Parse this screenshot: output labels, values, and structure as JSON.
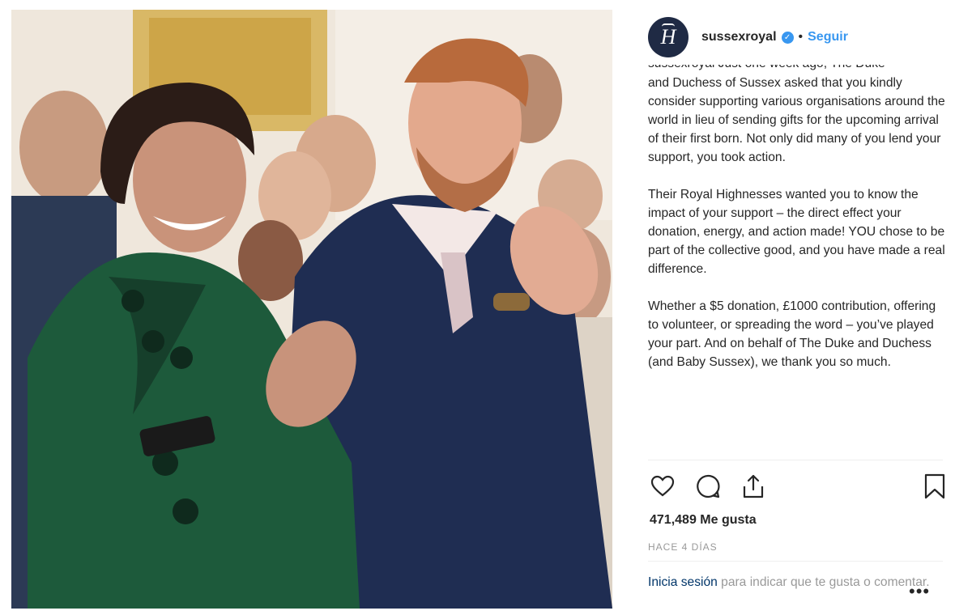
{
  "post": {
    "photo_alt": "",
    "header": {
      "avatar_letter": "H",
      "username": "sussexroyal",
      "verified_icon": "verified-badge-icon",
      "separator": "•",
      "follow_label": "Seguir"
    },
    "caption": {
      "clipped_line": "sussexroyal Just one week ago, The Duke",
      "paragraphs": [
        "and Duchess of Sussex asked that you kindly consider supporting various organisations around the world in lieu of sending gifts for the upcoming arrival of their first born. Not only did many of you lend your support, you took action.",
        "Their Royal Highnesses wanted you to know the impact of your support – the direct effect your donation, energy, and action made! YOU chose to be part of the collective good, and you have made a real difference.",
        "Whether a $5 donation, £1000 contribution, offering to volunteer, or spreading the word – you’ve played your part. And on behalf of The Duke and Duchess (and Baby Sussex), we thank you so much."
      ]
    },
    "actions": {
      "like_icon": "heart-icon",
      "comment_icon": "comment-icon",
      "share_icon": "share-icon",
      "save_icon": "bookmark-icon"
    },
    "likes_text": "471,489 Me gusta",
    "time_text": "HACE 4 DÍAS",
    "login": {
      "link_label": "Inicia sesión",
      "rest_text": " para indicar que te gusta o comentar.",
      "more_label": "•••"
    }
  },
  "colors": {
    "accent": "#3897f0",
    "text": "#262626",
    "muted": "#999999",
    "link": "#003569",
    "avatar_bg": "#1f2a44"
  }
}
